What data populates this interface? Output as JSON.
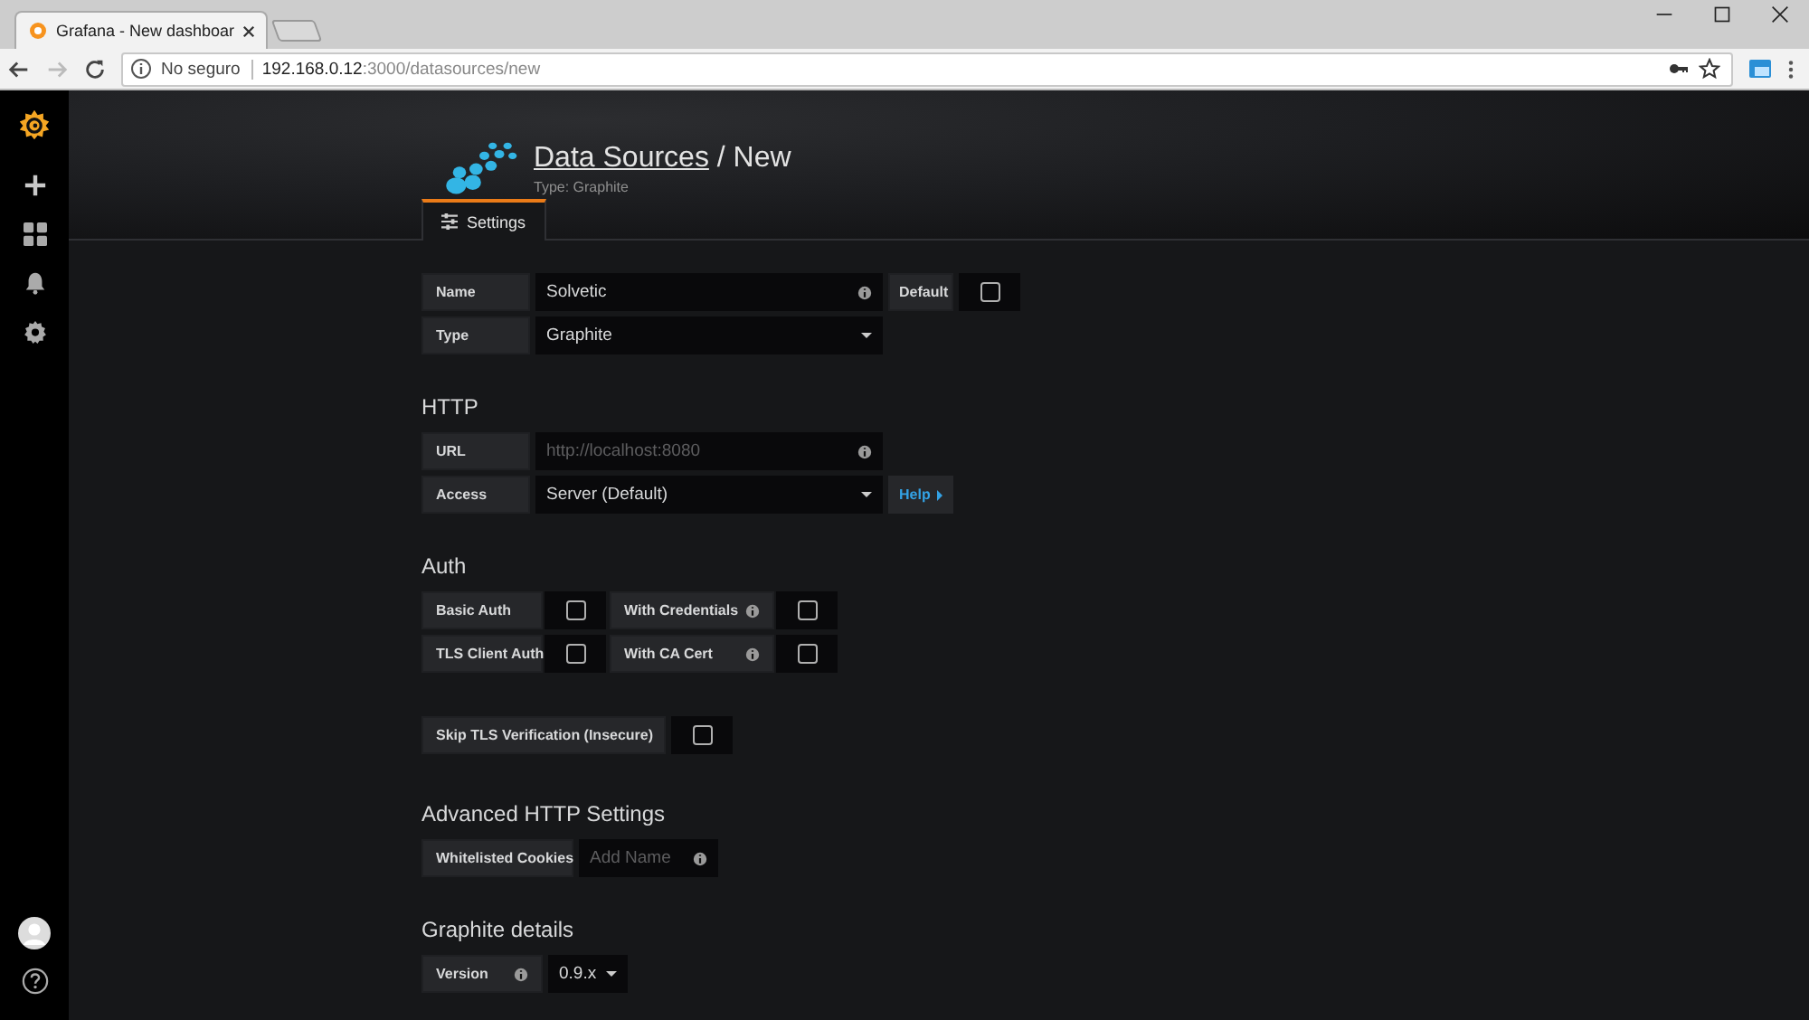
{
  "browser": {
    "tab": {
      "title": "Grafana - New dashboar"
    },
    "address": {
      "security": "No seguro",
      "host": "192.168.0.12",
      "path": ":3000/datasources/new"
    }
  },
  "header": {
    "breadcrumb_link": "Data Sources",
    "breadcrumb_rest": "/ New",
    "subtitle": "Type: Graphite"
  },
  "tabs": [
    {
      "label": "Settings",
      "selected": true
    }
  ],
  "sections": [
    {
      "kind": "general",
      "rows": [
        {
          "cells": [
            {
              "kind": "label",
              "text": "Name"
            },
            {
              "kind": "input",
              "value": "Solvetic",
              "info": true
            },
            {
              "kind": "label",
              "text": "Default"
            },
            {
              "kind": "checkbox",
              "checked": false
            }
          ]
        },
        {
          "cells": [
            {
              "kind": "label",
              "text": "Type"
            },
            {
              "kind": "select",
              "value": "Graphite"
            }
          ]
        }
      ]
    },
    {
      "kind": "http",
      "heading": "HTTP",
      "rows": [
        {
          "cells": [
            {
              "kind": "label",
              "text": "URL"
            },
            {
              "kind": "input",
              "placeholder": "http://localhost:8080",
              "info": true
            }
          ]
        },
        {
          "cells": [
            {
              "kind": "label",
              "text": "Access"
            },
            {
              "kind": "select",
              "value": "Server (Default)"
            },
            {
              "kind": "button",
              "text": "Help"
            }
          ]
        }
      ]
    },
    {
      "kind": "auth",
      "heading": "Auth",
      "rows": [
        {
          "cells": [
            {
              "kind": "label",
              "text": "Basic Auth"
            },
            {
              "kind": "checkbox",
              "checked": false
            },
            {
              "kind": "label",
              "text": "With Credentials",
              "info": true
            },
            {
              "kind": "checkbox",
              "checked": false
            }
          ]
        },
        {
          "cells": [
            {
              "kind": "label",
              "text": "TLS Client Auth"
            },
            {
              "kind": "checkbox",
              "checked": false
            },
            {
              "kind": "label",
              "text": "With CA Cert",
              "info": true
            },
            {
              "kind": "checkbox",
              "checked": false
            }
          ]
        }
      ]
    },
    {
      "kind": "tls",
      "rows": [
        {
          "cells": [
            {
              "kind": "label",
              "text": "Skip TLS Verification (Insecure)"
            },
            {
              "kind": "checkbox",
              "checked": false
            }
          ]
        }
      ]
    },
    {
      "kind": "advanced",
      "heading": "Advanced HTTP Settings",
      "rows": [
        {
          "cells": [
            {
              "kind": "label",
              "text": "Whitelisted Cookies"
            },
            {
              "kind": "input",
              "placeholder": "Add Name",
              "info": true
            }
          ]
        }
      ]
    },
    {
      "kind": "graphite",
      "heading": "Graphite details",
      "rows": [
        {
          "cells": [
            {
              "kind": "label",
              "text": "Version",
              "info": true
            },
            {
              "kind": "select",
              "value": "0.9.x"
            }
          ]
        }
      ]
    }
  ]
}
